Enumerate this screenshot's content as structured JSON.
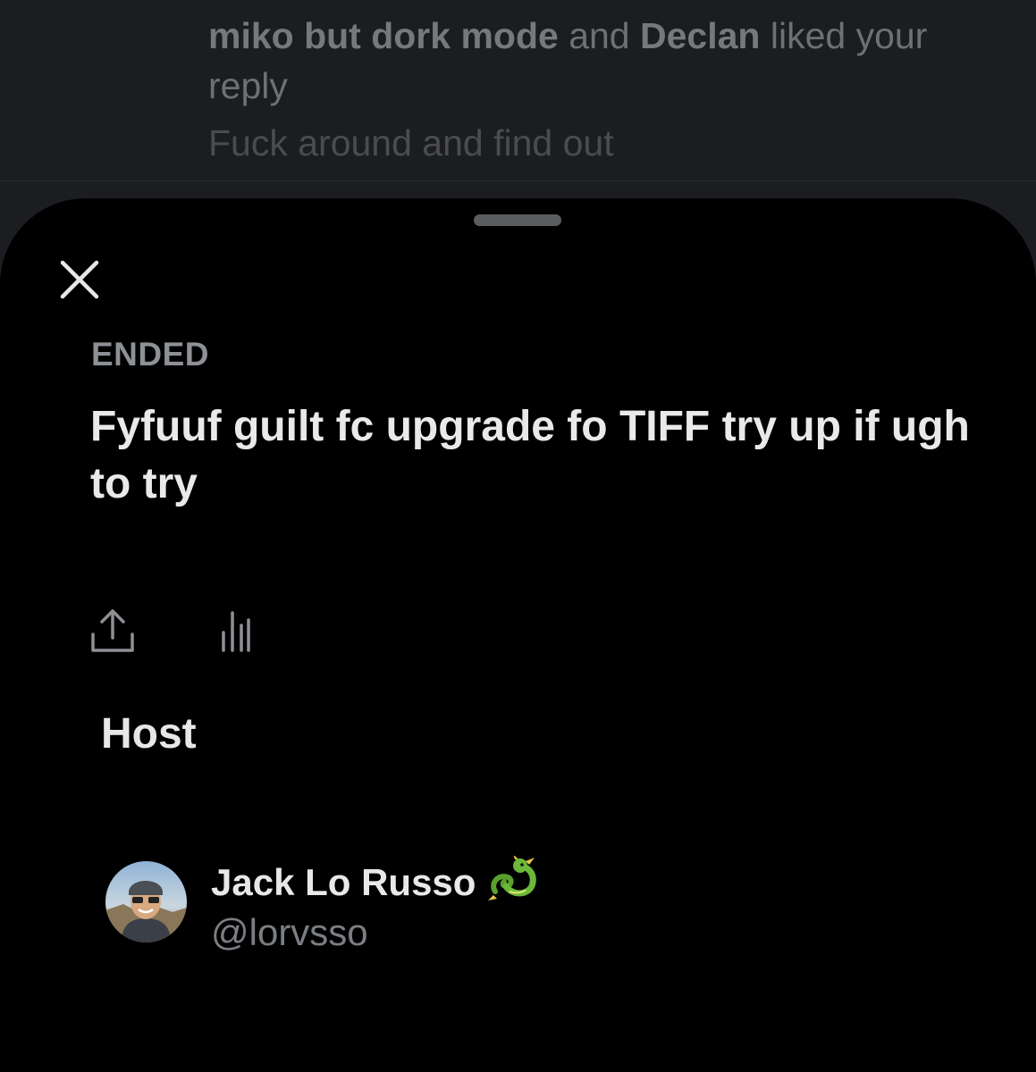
{
  "notification": {
    "user1": "miko but dork mode",
    "connector": " and ",
    "user2": "Declan",
    "action": " liked your reply",
    "reply_text": "Fuck around and find out"
  },
  "space": {
    "status": "ENDED",
    "title": "Fyfuuf guilt fc upgrade fo TIFF try up if ugh to try",
    "host_section_label": "Host",
    "host": {
      "name": "Jack Lo Russo",
      "handle": "@lorvsso",
      "badge_icon": "dragon-emoji"
    }
  },
  "icons": {
    "close": "close-icon",
    "share": "share-icon",
    "stats": "stats-icon"
  },
  "colors": {
    "sheet_bg": "#000000",
    "background": "#1c1d21",
    "muted_text": "#8d9095",
    "primary_text": "#e8e9ea"
  }
}
